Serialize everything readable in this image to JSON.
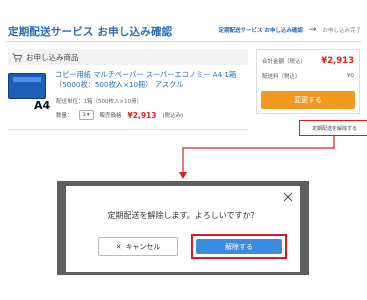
{
  "header": {
    "title": "定期配送サービス お申し込み確認",
    "steps": [
      "定期配送サービス お申し込み確認",
      "お申し込み完了"
    ]
  },
  "order": {
    "section_label": "お申し込み商品",
    "product_image_label": "A4",
    "product_name": "コピー用紙 マルチペーパー スーパーエコノミー A4 1箱（5000枚：500枚入×10冊） アスクル",
    "interval_text": "配送単位：1箱（500枚入×10冊）",
    "quantity_label": "数量：",
    "quantity_value": "1",
    "price_label": "販売価格",
    "price_value": "¥2,913",
    "price_tax": "(税込み)"
  },
  "summary": {
    "total_label": "合計金額（税込）",
    "total_value": "¥2,913",
    "shipping_label": "配送料（税込）",
    "shipping_value": "¥0",
    "change_button": "変更する"
  },
  "cancel_link": "定期配送を解除する",
  "dialog": {
    "message": "定期配送を解除します。よろしいですか？",
    "cancel_button": "キャンセル",
    "cancel_icon": "✕",
    "confirm_button": "解除する"
  },
  "colors": {
    "accent_blue": "#2a6cb4",
    "price_red": "#e02020",
    "orange_button": "#f29a20",
    "highlight_red": "#d81e1e",
    "confirm_blue": "#3d8be0"
  },
  "icons": [
    "cart-icon",
    "close-icon",
    "chevron-down-icon",
    "arrow-right-icon"
  ]
}
